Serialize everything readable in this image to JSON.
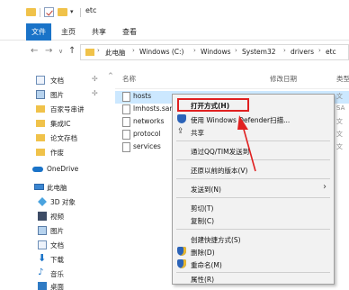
{
  "window": {
    "title": "etc"
  },
  "ribbon": {
    "tabs": [
      "文件",
      "主页",
      "共享",
      "查看"
    ]
  },
  "address": {
    "crumbs": [
      "此电脑",
      "Windows (C:)",
      "Windows",
      "System32",
      "drivers",
      "etc"
    ]
  },
  "nav": {
    "quick_items": [
      {
        "label": "文档",
        "icon": "document-icon"
      },
      {
        "label": "图片",
        "icon": "picture-icon"
      },
      {
        "label": "百家号串讲",
        "icon": "folder-icon"
      },
      {
        "label": "集成IC",
        "icon": "folder-icon"
      },
      {
        "label": "论文存档",
        "icon": "folder-icon"
      },
      {
        "label": "作废",
        "icon": "folder-icon"
      }
    ],
    "onedrive": "OneDrive",
    "pc": "此电脑",
    "pc_items": [
      {
        "label": "3D 对象",
        "icon": "cube-icon"
      },
      {
        "label": "视频",
        "icon": "video-icon"
      },
      {
        "label": "图片",
        "icon": "picture-icon"
      },
      {
        "label": "文档",
        "icon": "document-icon"
      },
      {
        "label": "下载",
        "icon": "download-icon"
      },
      {
        "label": "音乐",
        "icon": "music-icon"
      },
      {
        "label": "桌面",
        "icon": "desktop-icon"
      }
    ]
  },
  "filelist": {
    "headers": {
      "name": "名称",
      "date": "修改日期",
      "type": "类型"
    },
    "files": [
      {
        "name": "hosts",
        "type": "文"
      },
      {
        "name": "lmhosts.sam",
        "type": "SA"
      },
      {
        "name": "networks",
        "type": "文"
      },
      {
        "name": "protocol",
        "type": "文"
      },
      {
        "name": "services",
        "type": "文"
      }
    ]
  },
  "context_menu": {
    "open_with": "打开方式(H)",
    "defender": "使用 Windows Defender扫描...",
    "share": "共享",
    "qq": "通过QQ/TIM发送到",
    "restore": "还原以前的版本(V)",
    "send_to": "发送到(N)",
    "cut": "剪切(T)",
    "copy": "复制(C)",
    "shortcut": "创建快捷方式(S)",
    "delete": "删除(D)",
    "rename": "重命名(M)",
    "properties": "属性(R)"
  },
  "colors": {
    "accent": "#1a73c8",
    "highlight": "#e02020",
    "selection": "#cce8ff",
    "folder": "#f0c24a"
  }
}
